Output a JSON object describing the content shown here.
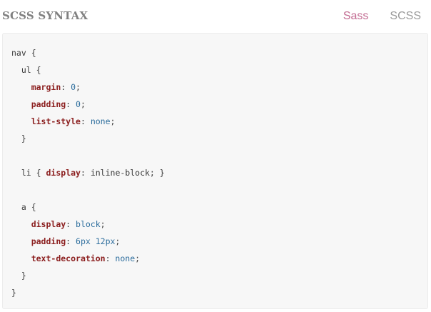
{
  "header": {
    "title": "SCSS SYNTAX",
    "tabs": [
      {
        "label": "Sass",
        "active": false
      },
      {
        "label": "SCSS",
        "active": true
      }
    ]
  },
  "colors": {
    "title": "#808080",
    "tab_sass": "#c26a91",
    "tab_scss": "#9a9a9a",
    "code_background": "#f7f7f7",
    "property": "#8b1e1e",
    "value": "#2f6f9e"
  },
  "code": {
    "lines": [
      {
        "indent": "",
        "tokens": [
          {
            "t": "sel",
            "v": "nav"
          },
          {
            "t": "punc",
            "v": " {"
          }
        ]
      },
      {
        "indent": "  ",
        "tokens": [
          {
            "t": "sel",
            "v": "ul"
          },
          {
            "t": "punc",
            "v": " {"
          }
        ]
      },
      {
        "indent": "    ",
        "tokens": [
          {
            "t": "prop",
            "v": "margin"
          },
          {
            "t": "punc",
            "v": ": "
          },
          {
            "t": "val",
            "v": "0"
          },
          {
            "t": "punc",
            "v": ";"
          }
        ]
      },
      {
        "indent": "    ",
        "tokens": [
          {
            "t": "prop",
            "v": "padding"
          },
          {
            "t": "punc",
            "v": ": "
          },
          {
            "t": "val",
            "v": "0"
          },
          {
            "t": "punc",
            "v": ";"
          }
        ]
      },
      {
        "indent": "    ",
        "tokens": [
          {
            "t": "prop",
            "v": "list-style"
          },
          {
            "t": "punc",
            "v": ": "
          },
          {
            "t": "val",
            "v": "none"
          },
          {
            "t": "punc",
            "v": ";"
          }
        ]
      },
      {
        "indent": "  ",
        "tokens": [
          {
            "t": "punc",
            "v": "}"
          }
        ]
      },
      {
        "indent": "",
        "tokens": []
      },
      {
        "indent": "  ",
        "tokens": [
          {
            "t": "sel",
            "v": "li"
          },
          {
            "t": "punc",
            "v": " { "
          },
          {
            "t": "prop",
            "v": "display"
          },
          {
            "t": "punc",
            "v": ": "
          },
          {
            "t": "sel",
            "v": "inline-block"
          },
          {
            "t": "punc",
            "v": "; }"
          }
        ]
      },
      {
        "indent": "",
        "tokens": []
      },
      {
        "indent": "  ",
        "tokens": [
          {
            "t": "sel",
            "v": "a"
          },
          {
            "t": "punc",
            "v": " {"
          }
        ]
      },
      {
        "indent": "    ",
        "tokens": [
          {
            "t": "prop",
            "v": "display"
          },
          {
            "t": "punc",
            "v": ": "
          },
          {
            "t": "val",
            "v": "block"
          },
          {
            "t": "punc",
            "v": ";"
          }
        ]
      },
      {
        "indent": "    ",
        "tokens": [
          {
            "t": "prop",
            "v": "padding"
          },
          {
            "t": "punc",
            "v": ": "
          },
          {
            "t": "val",
            "v": "6px 12px"
          },
          {
            "t": "punc",
            "v": ";"
          }
        ]
      },
      {
        "indent": "    ",
        "tokens": [
          {
            "t": "prop",
            "v": "text-decoration"
          },
          {
            "t": "punc",
            "v": ": "
          },
          {
            "t": "val",
            "v": "none"
          },
          {
            "t": "punc",
            "v": ";"
          }
        ]
      },
      {
        "indent": "  ",
        "tokens": [
          {
            "t": "punc",
            "v": "}"
          }
        ]
      },
      {
        "indent": "",
        "tokens": [
          {
            "t": "punc",
            "v": "}"
          }
        ]
      }
    ]
  }
}
